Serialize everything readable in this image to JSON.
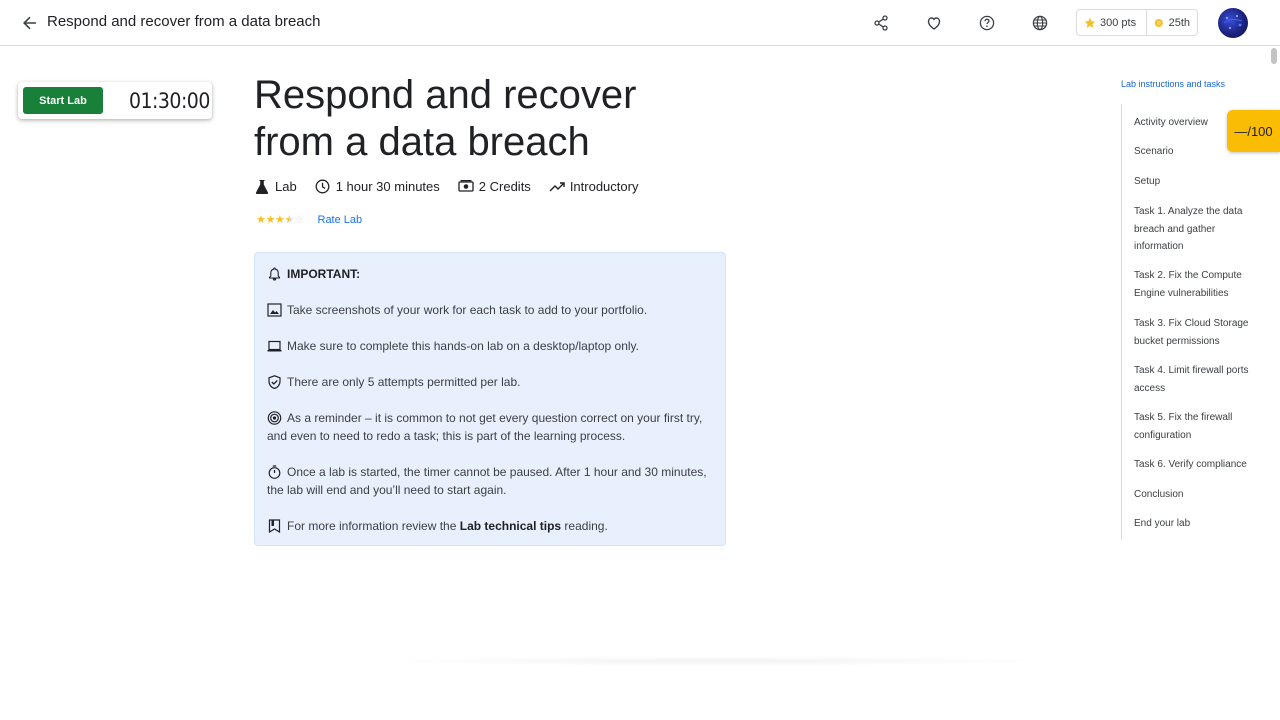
{
  "header": {
    "back_icon": "arrow-back-icon",
    "title": "Respond and recover from a data breach",
    "icons": [
      "share-icon",
      "favorite-icon",
      "help-icon",
      "language-icon"
    ],
    "points": "300 pts",
    "rank": "25th"
  },
  "lab_controls": {
    "start_label": "Start Lab",
    "timer": "01:30:00"
  },
  "main": {
    "title": "Respond and recover from a data breach",
    "meta": {
      "type": "Lab",
      "duration": "1 hour 30 minutes",
      "credits": "2 Credits",
      "level": "Introductory"
    },
    "rating": {
      "value": 3.5,
      "max": 5
    },
    "rate_label": "Rate Lab"
  },
  "important": {
    "heading": "IMPORTANT:",
    "items": [
      {
        "icon": "image-icon",
        "text": "Take screenshots of your work for each task to add to your portfolio."
      },
      {
        "icon": "laptop-icon",
        "text": "Make sure to complete this hands-on lab on a desktop/laptop only."
      },
      {
        "icon": "verified-shield-icon",
        "text": "There are only 5 attempts permitted per lab."
      },
      {
        "icon": "target-icon",
        "text": "As a reminder – it is common to not get every question correct on your first try, and even to need to redo a task; this is part of the learning process."
      },
      {
        "icon": "timer-icon",
        "text": "Once a lab is started, the timer cannot be paused. After 1 hour and 30 minutes, the lab will end and you’ll need to start again."
      }
    ],
    "tips": {
      "icon": "bookmark-icon",
      "prefix": "For more information review the ",
      "link": "Lab technical tips",
      "suffix": " reading."
    }
  },
  "toc": {
    "title": "Lab instructions and tasks",
    "items": [
      "Activity overview",
      "Scenario",
      "Setup",
      "Task 1. Analyze the data breach and gather information",
      "Task 2. Fix the Compute Engine vulnerabilities",
      "Task 3. Fix Cloud Storage bucket permissions",
      "Task 4. Limit firewall ports access",
      "Task 5. Fix the firewall configuration",
      "Task 6. Verify compliance",
      "Conclusion",
      "End your lab"
    ]
  },
  "score": "—/100",
  "colors": {
    "start_button": "#188038",
    "info_box": "#e8f0fe",
    "link": "#1a73e8",
    "score_badge": "#fbbc04",
    "star": "#f6bf26"
  }
}
